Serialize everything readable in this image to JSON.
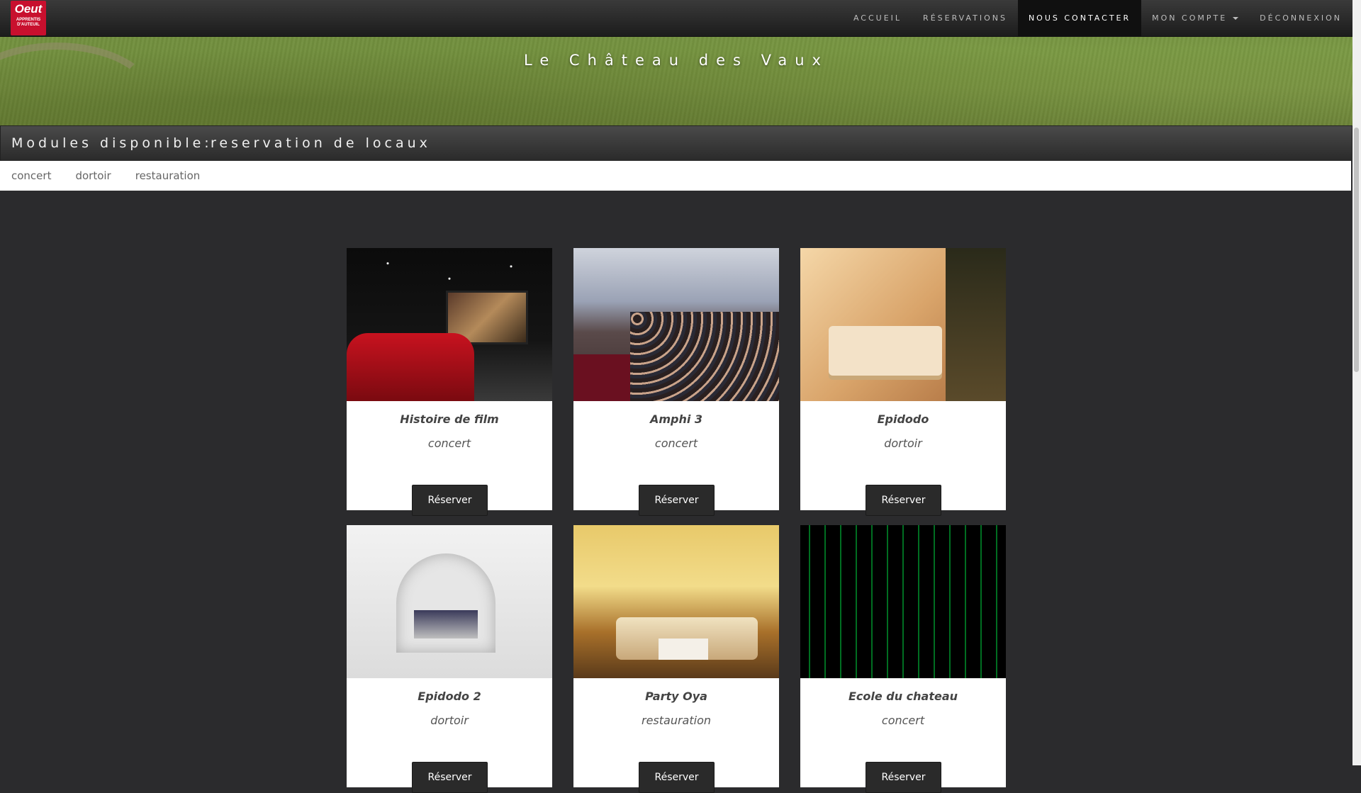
{
  "navbar": {
    "logo": {
      "mark": "Oeut",
      "line1": "APPRENTIS",
      "line2": "D'AUTEUIL"
    },
    "items": [
      {
        "label": "ACCUEIL",
        "active": false
      },
      {
        "label": "RÉSERVATIONS",
        "active": false
      },
      {
        "label": "NOUS CONTACTER",
        "active": true
      },
      {
        "label": "MON COMPTE",
        "active": false,
        "dropdown": true
      },
      {
        "label": "DÉCONNEXION",
        "active": false
      }
    ]
  },
  "hero": {
    "title": "Le Château des Vaux"
  },
  "section": {
    "label": "Modules disponible:",
    "subtitle": "reservation de locaux"
  },
  "filters": [
    "concert",
    "dortoir",
    "restauration"
  ],
  "cards": [
    {
      "name": "Histoire de film",
      "category": "concert",
      "button": "Réserver",
      "image": "cinema-room"
    },
    {
      "name": "Amphi 3",
      "category": "concert",
      "button": "Réserver",
      "image": "lecture-hall"
    },
    {
      "name": "Epidodo",
      "category": "dortoir",
      "button": "Réserver",
      "image": "bedroom"
    },
    {
      "name": "Epidodo 2",
      "category": "dortoir",
      "button": "Réserver",
      "image": "arched-bedroom"
    },
    {
      "name": "Party Oya",
      "category": "restauration",
      "button": "Réserver",
      "image": "salon"
    },
    {
      "name": "Ecole du chateau",
      "category": "concert",
      "button": "Réserver",
      "image": "matrix-code"
    }
  ]
}
